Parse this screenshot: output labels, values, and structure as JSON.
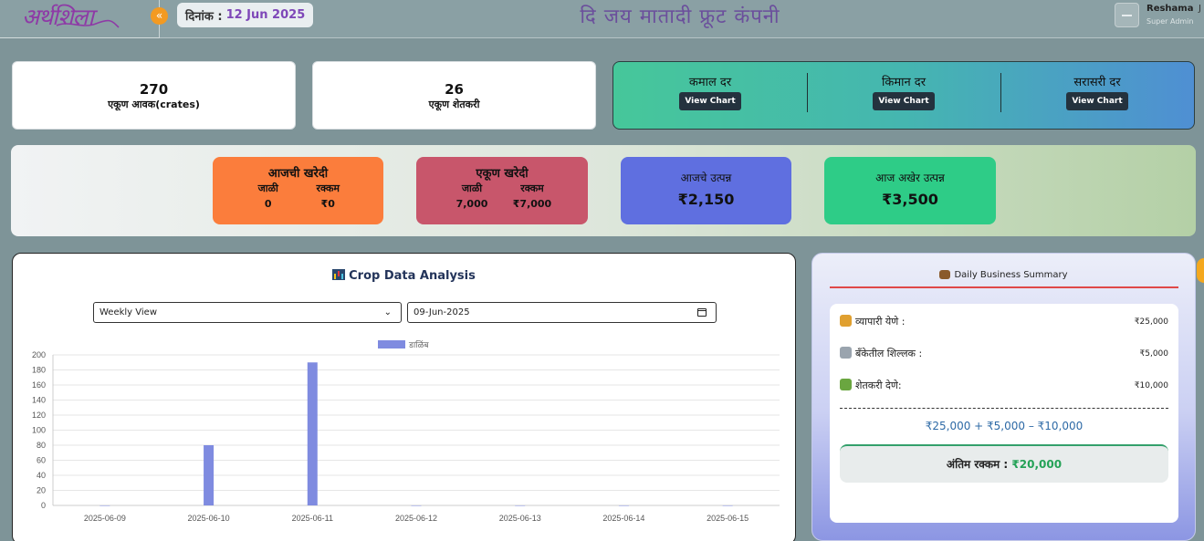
{
  "header": {
    "logo_text": "अर्थशिला",
    "date_label": "दिनांक :",
    "date_value": "12 Jun 2025",
    "company_title": "दि जय मातादी फ्रूट कंपनी",
    "user_name": "Reshama",
    "user_role": "Super Admin",
    "user_extra": "J",
    "collapse_icon": "«"
  },
  "stats": {
    "arrivals_value": "270",
    "arrivals_label": "एकूण आवक(crates)",
    "farmers_value": "26",
    "farmers_label": "एकूण शेतकरी"
  },
  "rates": [
    {
      "title": "कमाल दर",
      "button": "View Chart"
    },
    {
      "title": "किमान दर",
      "button": "View Chart"
    },
    {
      "title": "सरासरी दर",
      "button": "View Chart"
    }
  ],
  "purchases": {
    "today": {
      "title": "आजची खरेदी",
      "col1": "जाळी",
      "col2": "रक्कम",
      "val1": "0",
      "val2": "₹0",
      "color": "#fb7d3c"
    },
    "total": {
      "title": "एकूण खरेदी",
      "col1": "जाळी",
      "col2": "रक्कम",
      "val1": "7,000",
      "val2": "₹7,000",
      "color": "#c8566b"
    },
    "income_today": {
      "title": "आजचे उत्पन्न",
      "value": "₹2,150",
      "color": "#5f6fe0"
    },
    "income_total": {
      "title": "आज अखेर उत्पन्न",
      "value": "₹3,500",
      "color": "#2ecc87"
    }
  },
  "crop": {
    "title": "Crop Data Analysis",
    "view_select": "Weekly View",
    "date_input": "09-Jun-2025"
  },
  "chart_data": {
    "type": "bar",
    "categories": [
      "2025-06-09",
      "2025-06-10",
      "2025-06-11",
      "2025-06-12",
      "2025-06-13",
      "2025-06-14",
      "2025-06-15"
    ],
    "series": [
      {
        "name": "डाळिंब",
        "values": [
          0,
          80,
          190,
          0,
          0,
          0,
          0
        ],
        "color": "#7f8be0"
      }
    ],
    "ylim": [
      0,
      200
    ],
    "yticks": [
      0,
      20,
      40,
      60,
      80,
      100,
      120,
      140,
      160,
      180,
      200
    ],
    "grid": true,
    "legend": "top-center"
  },
  "summary": {
    "title": "Daily Business Summary",
    "rows": [
      {
        "label": "व्यापारी येणे :",
        "value": "₹25,000",
        "icon": "merchant-icon",
        "color": "#e0a030"
      },
      {
        "label": "बँकेतील शिल्लक :",
        "value": "₹5,000",
        "icon": "bank-icon",
        "color": "#9aa4ae"
      },
      {
        "label": "शेतकरी देणे:",
        "value": "₹10,000",
        "icon": "farmer-icon",
        "color": "#6aa640"
      }
    ],
    "formula": "₹25,000 + ₹5,000 – ₹10,000",
    "final_label": "अंतिम रक्कम :",
    "final_value": "₹20,000"
  }
}
